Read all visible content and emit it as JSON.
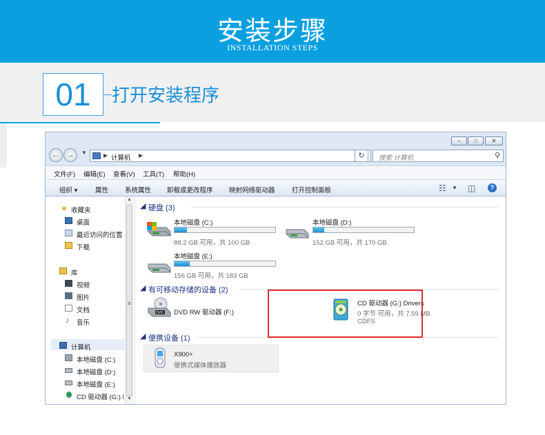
{
  "banner": {
    "title": "安装步骤",
    "subtitle": "INSTALLATION STEPS"
  },
  "step": {
    "number": "01",
    "title": "打开安装程序"
  },
  "window": {
    "caption_buttons": [
      "minimize-icon",
      "maximize-icon",
      "close-icon"
    ],
    "address": {
      "path": "计算机",
      "search_placeholder": "搜索 计算机"
    },
    "menu": [
      "文件(F)",
      "编辑(E)",
      "查看(V)",
      "工具(T)",
      "帮助(H)"
    ],
    "toolbar": [
      "组织 ▾",
      "属性",
      "系统属性",
      "卸载或更改程序",
      "映射网络驱动器",
      "打开控制面板"
    ],
    "nav": {
      "favorites": {
        "title": "收藏夹",
        "items": [
          "桌面",
          "最近访问的位置",
          "下载"
        ]
      },
      "library": {
        "title": "库",
        "items": [
          "视频",
          "图片",
          "文档",
          "音乐"
        ]
      },
      "computer": {
        "title": "计算机",
        "items": [
          "本地磁盘 (C:)",
          "本地磁盘 (D:)",
          "本地磁盘 (E:)",
          "CD 驱动器 (G:) D"
        ]
      }
    },
    "groups": {
      "hard_disks": {
        "title": "硬盘 (3)",
        "drives": [
          {
            "name": "本地磁盘 (C:)",
            "free": "88.2 GB 可用，共 100 GB",
            "used_fraction": 0.12
          },
          {
            "name": "本地磁盘 (D:)",
            "free": "152 GB 可用，共 170 GB",
            "used_fraction": 0.11
          },
          {
            "name": "本地磁盘 (E:)",
            "free": "156 GB 可用，共 183 GB",
            "used_fraction": 0.15
          }
        ]
      },
      "removable": {
        "title": "有可移动存储的设备 (2)",
        "dvd": {
          "name": "DVD RW 驱动器 (F:)"
        },
        "cd": {
          "name": "CD 驱动器 (G:) Drivers",
          "free": "0 字节 可用，共 7.59 MB",
          "fs": "CDFS"
        }
      },
      "portable": {
        "title": "便携设备 (1)",
        "device": {
          "name": "X900+",
          "type": "便携式媒体播放器"
        }
      }
    }
  },
  "colors": {
    "banner": "#0aa0e0",
    "step_accent": "#1a8ed8",
    "highlight": "#e52a2a",
    "group_title": "#1e3287"
  }
}
